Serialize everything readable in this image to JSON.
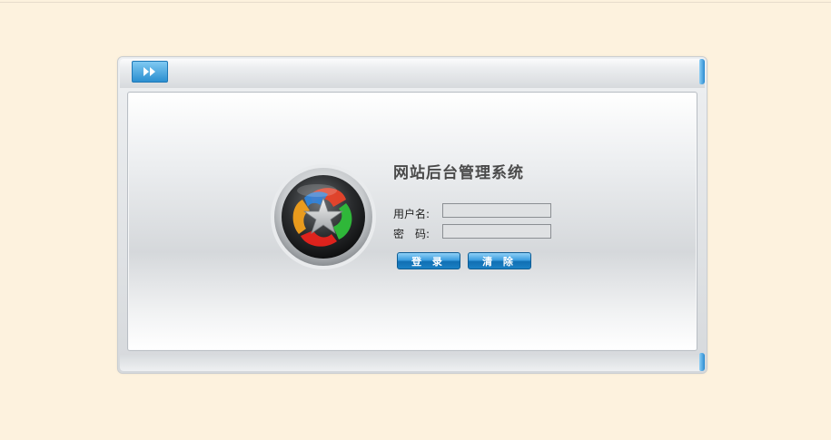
{
  "login": {
    "title": "网站后台管理系统",
    "username_label": "用户名:",
    "username_value": "",
    "password_label": "密　码:",
    "password_value": "",
    "login_button": "登 录",
    "clear_button": "清 除"
  },
  "colors": {
    "background": "#fdf2de",
    "button_blue": "#1b80c4",
    "title_text": "#4a4a4a"
  },
  "icons": {
    "titlebar_button": "double-chevron-right-icon",
    "logo": "star-logo-icon"
  }
}
